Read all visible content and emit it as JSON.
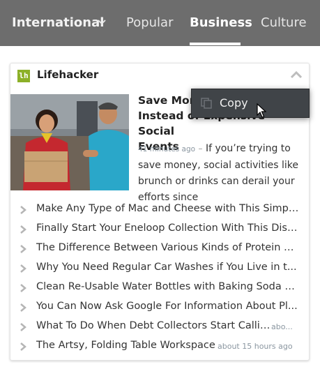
{
  "nav": {
    "edition_label": "International",
    "tabs": [
      {
        "label": "Popular"
      },
      {
        "label": "Business"
      },
      {
        "label": "Culture"
      }
    ],
    "active_tab": "Business"
  },
  "card": {
    "source_name": "Lifehacker",
    "source_logo_text": "lh",
    "source_color": "#8cb028",
    "featured": {
      "headline": "Save Money by Being Social Instead of Expensive Social Events",
      "headline_visible_line1": "Save Mone",
      "headline_visible_line2": "Instead of",
      "headline_visible_line2b": "Expensive Social",
      "headline_visible_line3": "Events",
      "timestamp": "41 minutes ago",
      "separator": "–",
      "snippet": "If you’re trying to save money, social activities like brunch or drinks can derail your efforts since"
    },
    "items": [
      {
        "title": "Make Any Type of Mac and Cheese with This Simpl..."
      },
      {
        "title": "Finally Start Your Eneloop Collection With This Disc..."
      },
      {
        "title": "The Difference Between Various Kinds of Protein S..."
      },
      {
        "title": "Why You Need Regular Car Washes if You Live in t..."
      },
      {
        "title": "Clean Re-Usable Water Bottles with Baking Soda a..."
      },
      {
        "title": "You Can Now Ask Google For Information About Pl..."
      },
      {
        "title": "What To Do When Debt Collectors Start Calling",
        "age": "abo..."
      },
      {
        "title": "The Artsy, Folding Table Workspace",
        "age": "about 15 hours ago"
      }
    ]
  },
  "context_menu": {
    "items": [
      {
        "label": "Copy",
        "icon": "copy-icon"
      }
    ]
  },
  "colors": {
    "nav_bg": "#6d6d6d",
    "menu_bg": "#404448",
    "accent": "#8cb028"
  }
}
